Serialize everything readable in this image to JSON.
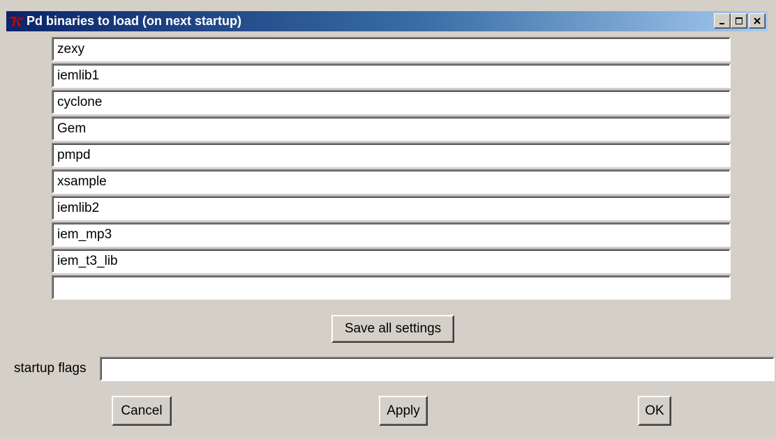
{
  "window": {
    "title": "Pd binaries to load (on next startup)",
    "icon": "tk-icon",
    "controls": {
      "minimize_icon": "minimize-icon",
      "maximize_icon": "maximize-icon",
      "close_icon": "close-icon"
    }
  },
  "binaries": {
    "entries": [
      "zexy",
      "iemlib1",
      "cyclone",
      "Gem",
      "pmpd",
      "xsample",
      "iemlib2",
      "iem_mp3",
      "iem_t3_lib",
      ""
    ]
  },
  "save_all_settings_label": "Save all settings",
  "startup_flags": {
    "label": "startup flags",
    "value": ""
  },
  "buttons": {
    "cancel": "Cancel",
    "apply": "Apply",
    "ok": "OK"
  },
  "colors": {
    "titlebar_start": "#0a246a",
    "titlebar_end": "#a6caf0",
    "window_bg": "#d4d0c8",
    "tk_icon": "#cc0000"
  }
}
